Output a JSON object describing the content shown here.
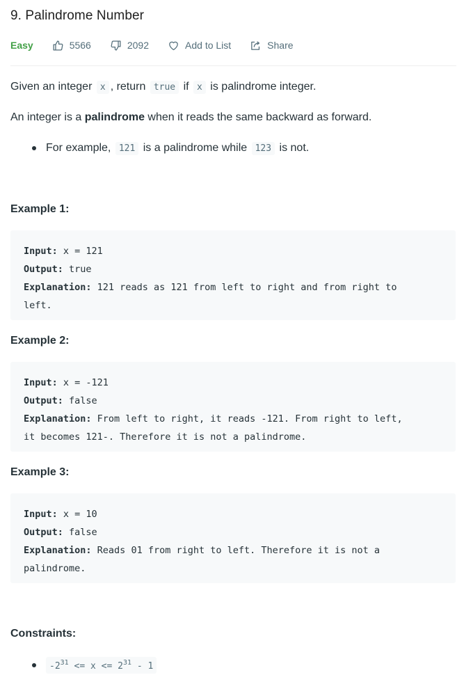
{
  "problem": {
    "title": "9. Palindrome Number",
    "difficulty": "Easy",
    "likes": "5566",
    "dislikes": "2092",
    "add_to_list": "Add to List",
    "share": "Share"
  },
  "description": {
    "p1": {
      "t1": "Given an integer ",
      "c1": "x",
      "t2": ", return ",
      "c2": "true",
      "t3": " if ",
      "c3": "x",
      "t4": " is palindrome integer."
    },
    "p2": {
      "t1": "An integer is a ",
      "bold": "palindrome",
      "t2": " when it reads the same backward as forward."
    },
    "bullet": {
      "t1": "For example, ",
      "c1": "121",
      "t2": " is a palindrome while ",
      "c2": "123",
      "t3": " is not."
    }
  },
  "examples": [
    {
      "heading": "Example 1:",
      "input_label": "Input:",
      "input": " x = 121",
      "output_label": "Output:",
      "output": " true",
      "explanation_label": "Explanation:",
      "explanation": " 121 reads as 121 from left to right and from right to\nleft."
    },
    {
      "heading": "Example 2:",
      "input_label": "Input:",
      "input": " x = -121",
      "output_label": "Output:",
      "output": " false",
      "explanation_label": "Explanation:",
      "explanation": " From left to right, it reads -121. From right to left,\nit becomes 121-. Therefore it is not a palindrome."
    },
    {
      "heading": "Example 3:",
      "input_label": "Input:",
      "input": " x = 10",
      "output_label": "Output:",
      "output": " false",
      "explanation_label": "Explanation:",
      "explanation": " Reads 01 from right to left. Therefore it is not a\npalindrome."
    }
  ],
  "constraints": {
    "heading": "Constraints:",
    "lower_base": "-2",
    "lower_exp": "31",
    "middle": " <= x <= 2",
    "upper_exp": "31",
    "tail": " - 1"
  },
  "colors": {
    "easy": "#43a047",
    "muted": "#546e7a",
    "code_bg": "#f7f9fa"
  }
}
